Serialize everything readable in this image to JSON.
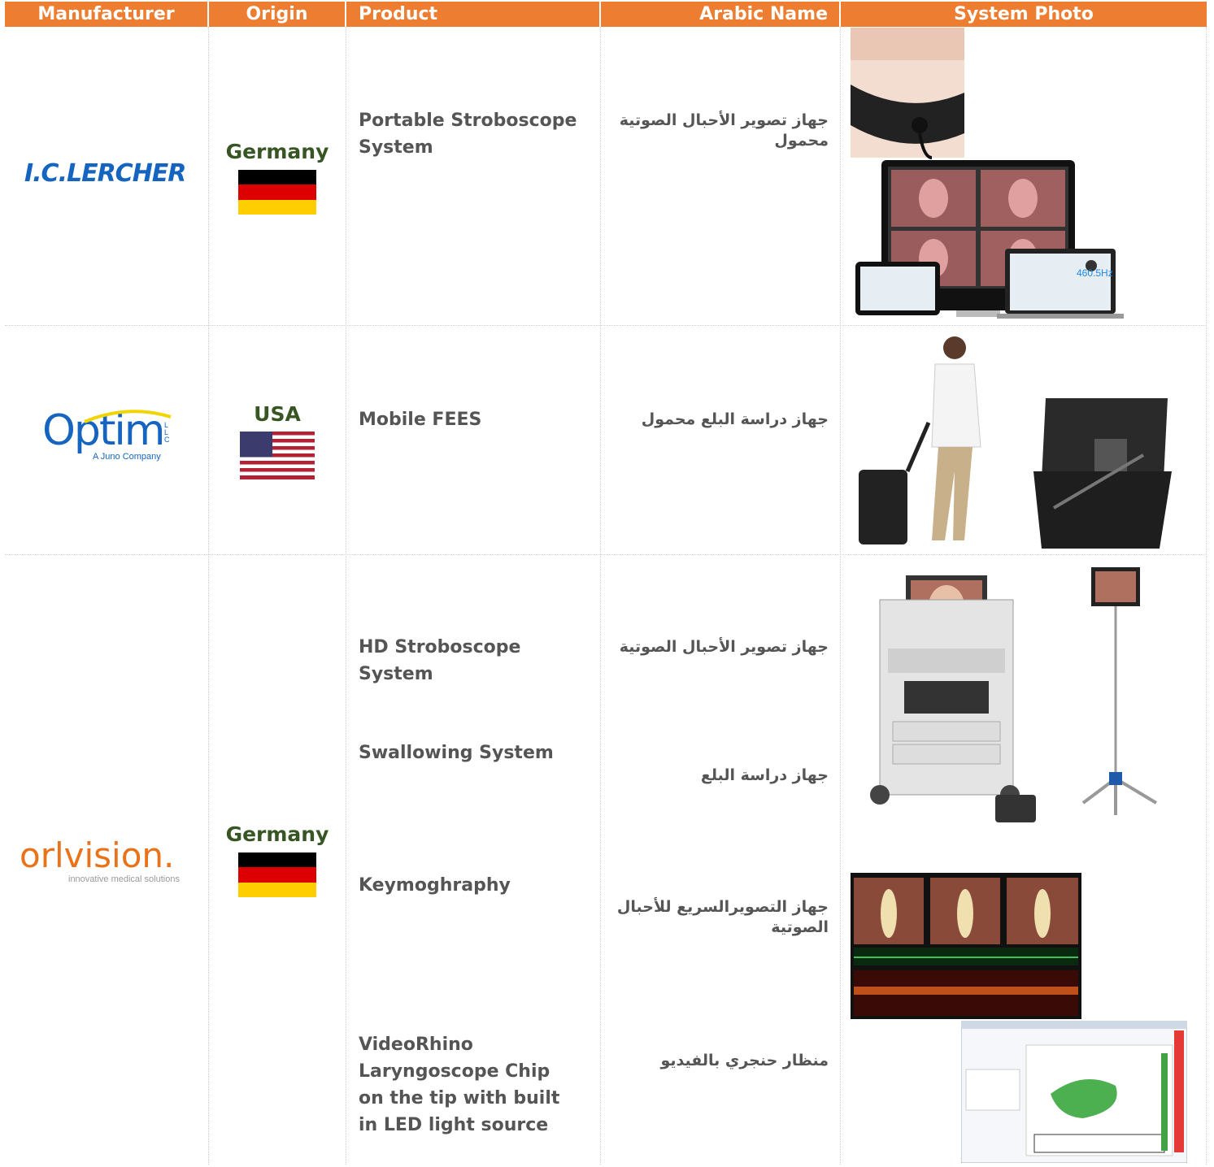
{
  "headers": [
    "Manufacturer",
    "Origin",
    "Product",
    "Arabic Name",
    "System Photo"
  ],
  "rows": [
    {
      "manufacturer": "I.C.LERCHER",
      "origin": "Germany",
      "products": [
        "Portable Stroboscope System"
      ],
      "arabic": [
        "جهاز تصوير الأحبال الصوتية محمول"
      ],
      "photo_text": "460.5Hz"
    },
    {
      "manufacturer": "Optim",
      "manufacturer_llc": "LLC",
      "manufacturer_tag": "A Juno Company",
      "origin": "USA",
      "products": [
        "Mobile FEES"
      ],
      "arabic": [
        "جهاز دراسة البلع محمول"
      ]
    },
    {
      "manufacturer": "orlvision",
      "manufacturer_tag": "innovative medical solutions",
      "origin": "Germany",
      "products": [
        "HD Stroboscope System",
        "Swallowing System",
        "Keymoghraphy",
        "VideoRhino Laryngoscope Chip on the tip with built in LED light source"
      ],
      "arabic": [
        "جهاز تصوير الأحبال الصوتية",
        "جهاز دراسة البلع",
        "جهاز التصويرالسريع للأحبال الصوتية",
        "منظار حنجري بالفيديو"
      ]
    }
  ],
  "colors": {
    "header_bg": "#ED7D31",
    "origin_green": "#375623",
    "lercher_blue": "#1565C0",
    "orl_orange": "#E8731A"
  }
}
